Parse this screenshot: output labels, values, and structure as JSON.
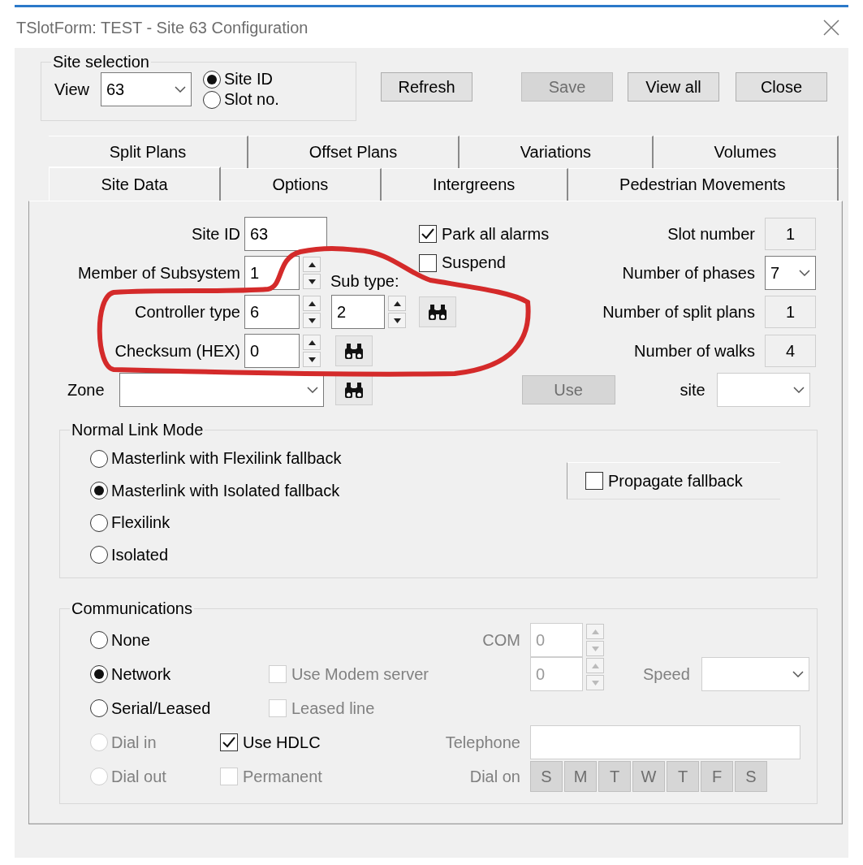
{
  "window": {
    "title": "TSlotForm: TEST - Site 63 Configuration"
  },
  "site_selection": {
    "title": "Site selection",
    "view_label": "View",
    "view_value": "63",
    "modes": [
      {
        "label": "Site ID",
        "selected": true
      },
      {
        "label": "Slot no.",
        "selected": false
      }
    ]
  },
  "buttons": [
    {
      "label": "Refresh",
      "disabled": false
    },
    {
      "label": "Save",
      "disabled": true
    },
    {
      "label": "View all",
      "disabled": false
    },
    {
      "label": "Close",
      "disabled": false
    }
  ],
  "tabs_back": [
    {
      "label": "Split Plans",
      "selected": false
    },
    {
      "label": "Offset Plans",
      "selected": false
    },
    {
      "label": "Variations",
      "selected": false
    },
    {
      "label": "Volumes",
      "selected": false
    }
  ],
  "tabs_front": [
    {
      "label": "Site Data",
      "selected": true
    },
    {
      "label": "Options",
      "selected": false
    },
    {
      "label": "Intergreens",
      "selected": false
    },
    {
      "label": "Pedestrian Movements",
      "selected": false
    }
  ],
  "site_data": {
    "site_id": {
      "label": "Site ID",
      "value": "63"
    },
    "member_of_subsystem": {
      "label": "Member of Subsystem",
      "value": "1"
    },
    "controller_type": {
      "label": "Controller type",
      "value": "6"
    },
    "sub_type": {
      "label": "Sub type:",
      "value": "2"
    },
    "checksum": {
      "label": "Checksum (HEX)",
      "value": "0"
    },
    "zone": {
      "label": "Zone"
    },
    "checkboxes": [
      {
        "label": "Park all alarms",
        "checked": true
      },
      {
        "label": "Suspend",
        "checked": false
      }
    ],
    "info": [
      {
        "label": "Slot number",
        "value": "1",
        "kind": "readonly"
      },
      {
        "label": "Number of phases",
        "value": "7",
        "kind": "combo"
      },
      {
        "label": "Number of split plans",
        "value": "1",
        "kind": "readonly"
      },
      {
        "label": "Number of walks",
        "value": "4",
        "kind": "readonly"
      }
    ],
    "use_button": {
      "label": "Use",
      "disabled": true
    },
    "site_combo": {
      "label": "site"
    }
  },
  "normal_link_mode": {
    "title": "Normal Link Mode",
    "options": [
      {
        "label": "Masterlink with Flexilink fallback",
        "selected": false
      },
      {
        "label": "Masterlink with Isolated fallback",
        "selected": true
      },
      {
        "label": "Flexilink",
        "selected": false
      },
      {
        "label": "Isolated",
        "selected": false
      }
    ],
    "propagate_fallback": {
      "label": "Propagate fallback",
      "checked": false
    }
  },
  "communications": {
    "title": "Communications",
    "modes": [
      {
        "label": "None",
        "selected": false,
        "disabled": false
      },
      {
        "label": "Network",
        "selected": true,
        "disabled": false
      },
      {
        "label": "Serial/Leased",
        "selected": false,
        "disabled": false
      },
      {
        "label": "Dial in",
        "selected": false,
        "disabled": true
      },
      {
        "label": "Dial out",
        "selected": false,
        "disabled": true
      }
    ],
    "options": [
      {
        "label": "Use Modem server",
        "checked": false,
        "disabled": true
      },
      {
        "label": "Leased line",
        "checked": false,
        "disabled": true
      },
      {
        "label": "Use HDLC",
        "checked": true,
        "disabled": false
      },
      {
        "label": "Permanent",
        "checked": false,
        "disabled": true
      }
    ],
    "com": {
      "label": "COM",
      "value": "0",
      "disabled": true
    },
    "port": {
      "value": "0",
      "disabled": true
    },
    "speed": {
      "label": "Speed",
      "disabled": true
    },
    "telephone": {
      "label": "Telephone",
      "disabled": true
    },
    "dial_on": {
      "label": "Dial on",
      "days": [
        {
          "label": "S",
          "disabled": true
        },
        {
          "label": "M",
          "disabled": true
        },
        {
          "label": "T",
          "disabled": true
        },
        {
          "label": "W",
          "disabled": true
        },
        {
          "label": "T",
          "disabled": true
        },
        {
          "label": "F",
          "disabled": true
        },
        {
          "label": "S",
          "disabled": true
        }
      ]
    }
  }
}
